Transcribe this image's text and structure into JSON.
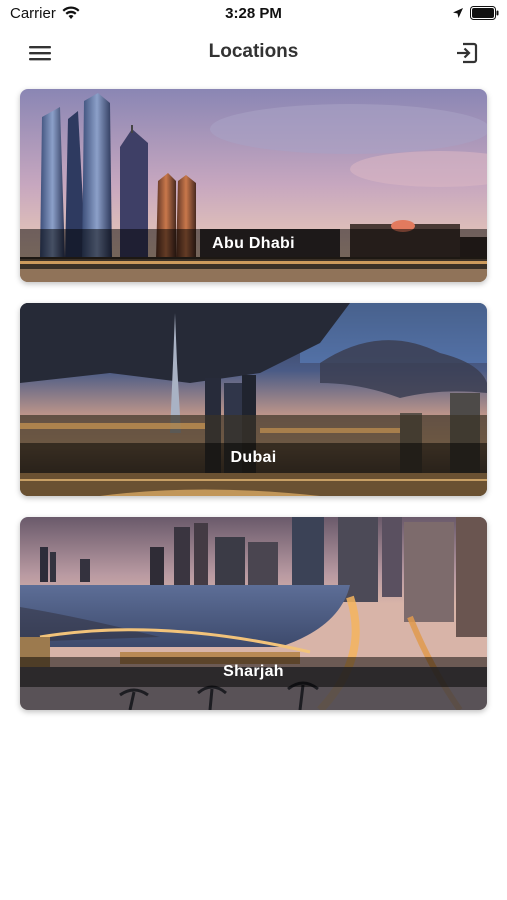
{
  "status_bar": {
    "carrier": "Carrier",
    "time": "3:28 PM"
  },
  "nav": {
    "title": "Locations",
    "menu_icon": "hamburger-menu-icon",
    "logout_icon": "logout-icon"
  },
  "locations": [
    {
      "name": "Abu Dhabi"
    },
    {
      "name": "Dubai"
    },
    {
      "name": "Sharjah"
    }
  ]
}
